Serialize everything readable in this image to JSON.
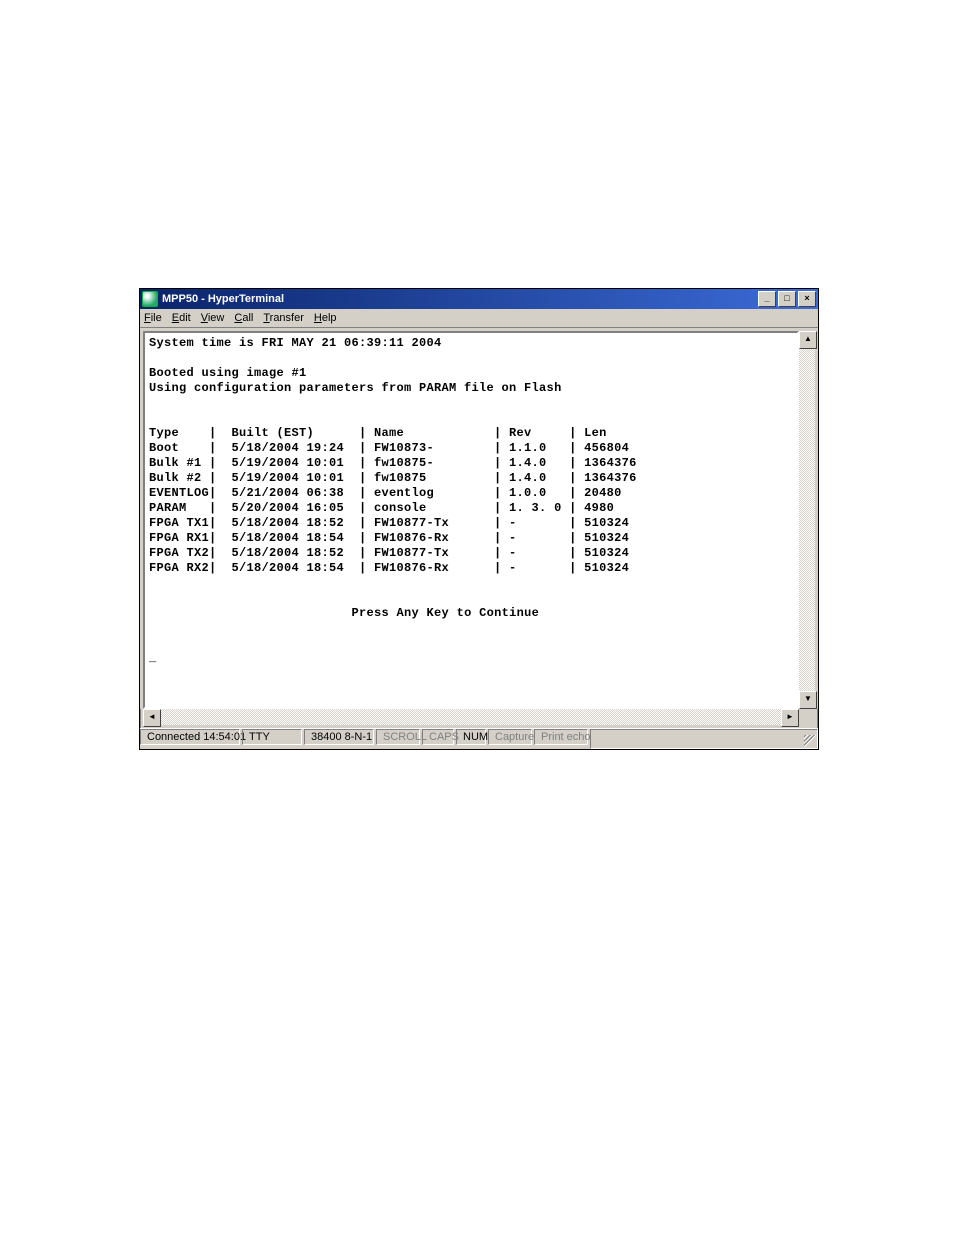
{
  "window": {
    "title": "MPP50 - HyperTerminal"
  },
  "menu": {
    "file": "File",
    "edit": "Edit",
    "view": "View",
    "call": "Call",
    "transfer": "Transfer",
    "help": "Help"
  },
  "terminal": {
    "sys_time": "System time is FRI MAY 21 06:39:11 2004",
    "booted": "Booted using image #1",
    "using_cfg": "Using configuration parameters from PARAM file on Flash",
    "header": "Type    |  Built (EST)      | Name            | Rev     | Len",
    "rows": {
      "r0": "Boot    |  5/18/2004 19:24  | FW10873-        | 1.1.0   | 456804",
      "r1": "Bulk #1 |  5/19/2004 10:01  | fw10875-        | 1.4.0   | 1364376",
      "r2": "Bulk #2 |  5/19/2004 10:01  | fw10875         | 1.4.0   | 1364376",
      "r3": "EVENTLOG|  5/21/2004 06:38  | eventlog        | 1.0.0   | 20480",
      "r4": "PARAM   |  5/20/2004 16:05  | console         | 1. 3. 0 | 4980",
      "r5": "FPGA TX1|  5/18/2004 18:52  | FW10877-Tx      | -       | 510324",
      "r6": "FPGA RX1|  5/18/2004 18:54  | FW10876-Rx      | -       | 510324",
      "r7": "FPGA TX2|  5/18/2004 18:52  | FW10877-Tx      | -       | 510324",
      "r8": "FPGA RX2|  5/18/2004 18:54  | FW10876-Rx      | -       | 510324"
    },
    "press_any": "Press Any Key to Continue",
    "cursor": "_"
  },
  "status": {
    "connected": "Connected 14:54:01",
    "tty": "TTY",
    "baud": "38400 8-N-1",
    "scroll": "SCROLL",
    "caps": "CAPS",
    "num": "NUM",
    "capture": "Capture",
    "printecho": "Print echo"
  },
  "winbuttons": {
    "min": "_",
    "max": "□",
    "close": "×"
  },
  "scroll": {
    "up": "▲",
    "down": "▼",
    "left": "◄",
    "right": "►"
  }
}
